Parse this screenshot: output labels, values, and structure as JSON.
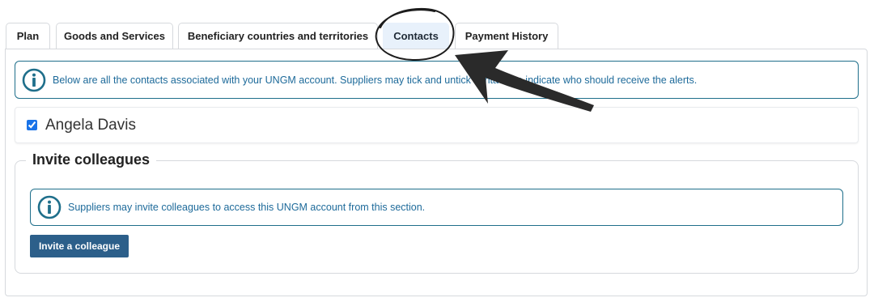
{
  "tabs": [
    {
      "label": "Plan",
      "active": false
    },
    {
      "label": "Goods and Services",
      "active": false
    },
    {
      "label": "Beneficiary countries and territories",
      "active": false
    },
    {
      "label": "Contacts",
      "active": true
    },
    {
      "label": "Payment History",
      "active": false
    }
  ],
  "contacts_info": "Below are all the contacts associated with your UNGM account. Suppliers may tick and untick contacts to indicate who should receive the alerts.",
  "contacts": [
    {
      "name": "Angela Davis",
      "checked": true
    }
  ],
  "invite": {
    "title": "Invite colleagues",
    "info": "Suppliers may invite colleagues to access this UNGM account from this section.",
    "button_label": "Invite a colleague"
  },
  "colors": {
    "accent": "#1f6f8b",
    "info_text": "#1d6a9a",
    "button": "#2c5f8a",
    "active_tab": "#e8f1fb"
  }
}
